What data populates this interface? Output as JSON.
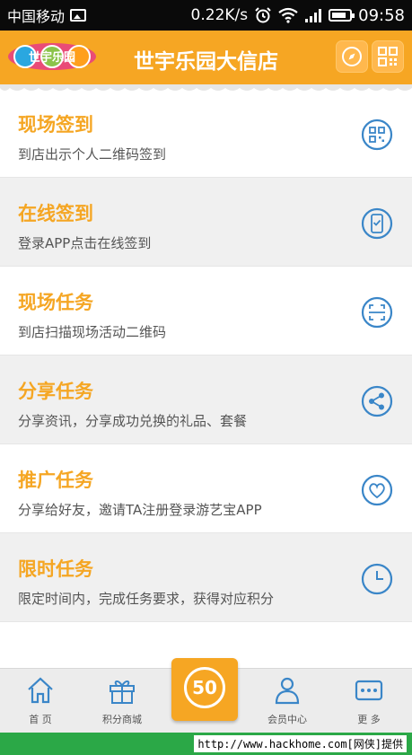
{
  "status_bar": {
    "carrier": "中国移动",
    "speed": "0.22K/s",
    "time": "09:58"
  },
  "app_bar": {
    "logo_text": "世宇乐园",
    "title": "世宇乐园大信店"
  },
  "tasks": [
    {
      "title": "现场签到",
      "desc": "到店出示个人二维码签到",
      "icon": "qr-code-icon"
    },
    {
      "title": "在线签到",
      "desc": "登录APP点击在线签到",
      "icon": "phone-check-icon"
    },
    {
      "title": "现场任务",
      "desc": "到店扫描现场活动二维码",
      "icon": "scan-icon"
    },
    {
      "title": "分享任务",
      "desc": "分享资讯，分享成功兑换的礼品、套餐",
      "icon": "share-icon"
    },
    {
      "title": "推广任务",
      "desc": "分享给好友，邀请TA注册登录游艺宝APP",
      "icon": "heart-icon"
    },
    {
      "title": "限时任务",
      "desc": "限定时间内，完成任务要求，获得对应积分",
      "icon": "clock-icon"
    }
  ],
  "tab_bar": {
    "home": "首 页",
    "points_mall": "积分商城",
    "center_value": "50",
    "member_center": "会员中心",
    "more": "更 多"
  },
  "footer": {
    "watermark": "http://www.hackhome.com[网侠]提供"
  },
  "colors": {
    "accent": "#f6a623",
    "icon_blue": "#3a86c8",
    "footer_green": "#2ba847"
  }
}
